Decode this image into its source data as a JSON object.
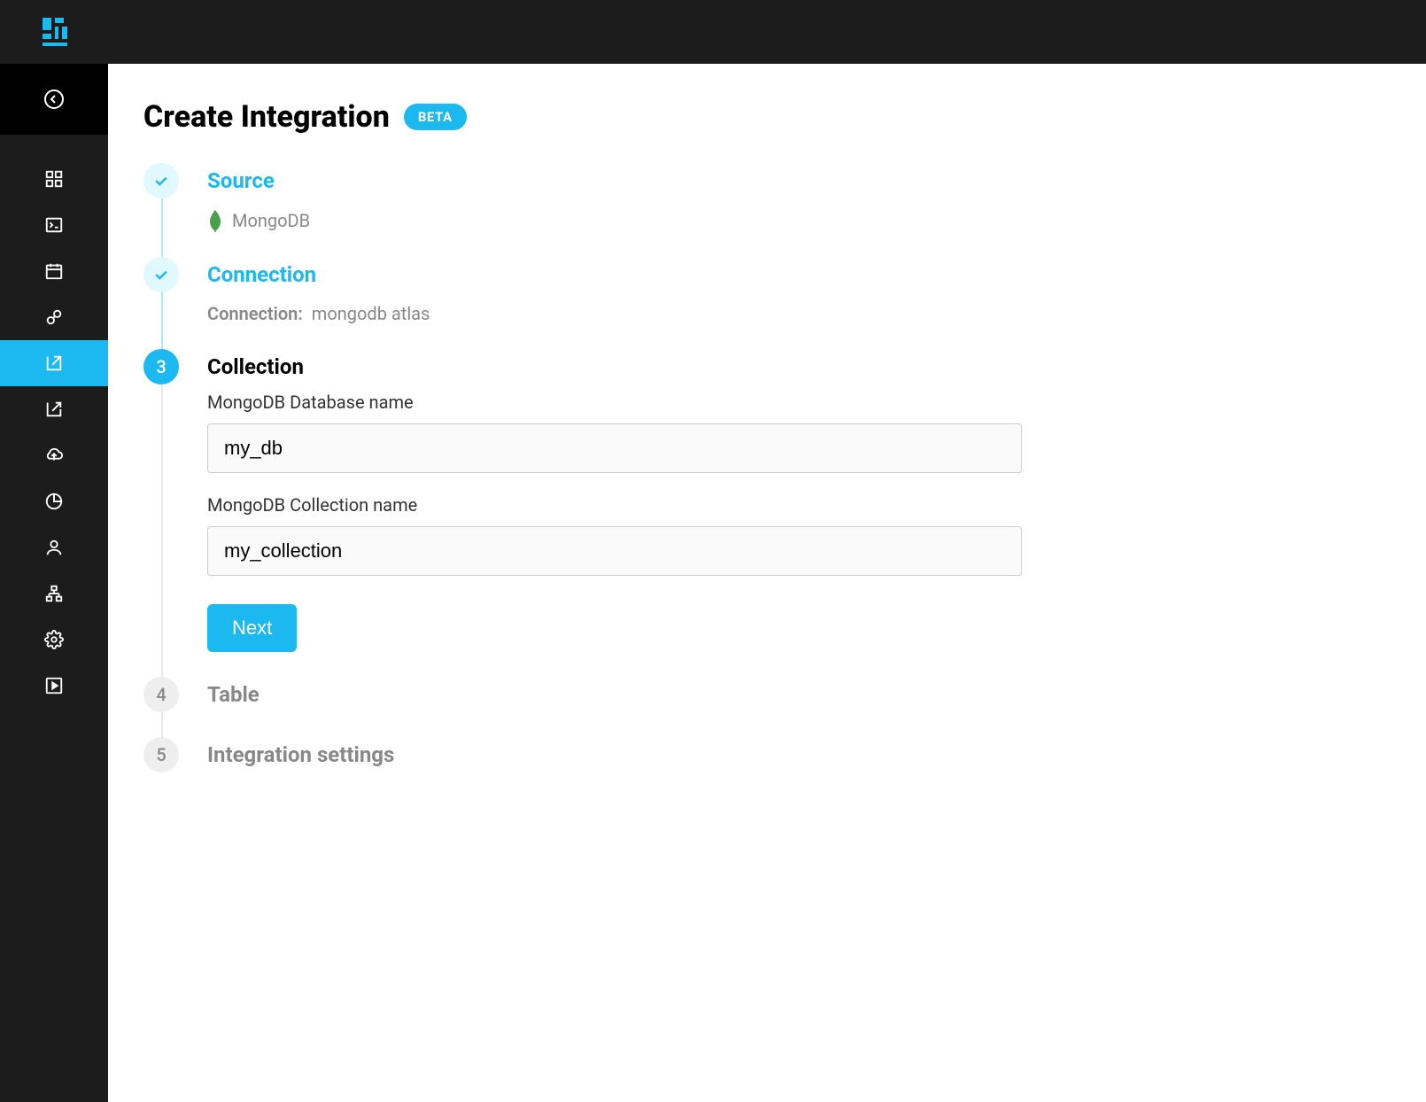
{
  "header": {
    "title": "Create Integration",
    "badge": "BETA"
  },
  "steps": {
    "source": {
      "title": "Source",
      "value": "MongoDB"
    },
    "connection": {
      "title": "Connection",
      "sub_label": "Connection:",
      "sub_value": "mongodb atlas"
    },
    "collection": {
      "number": "3",
      "title": "Collection",
      "db_label": "MongoDB Database name",
      "db_value": "my_db",
      "coll_label": "MongoDB Collection name",
      "coll_value": "my_collection",
      "next_label": "Next"
    },
    "table": {
      "number": "4",
      "title": "Table"
    },
    "settings": {
      "number": "5",
      "title": "Integration settings"
    }
  }
}
